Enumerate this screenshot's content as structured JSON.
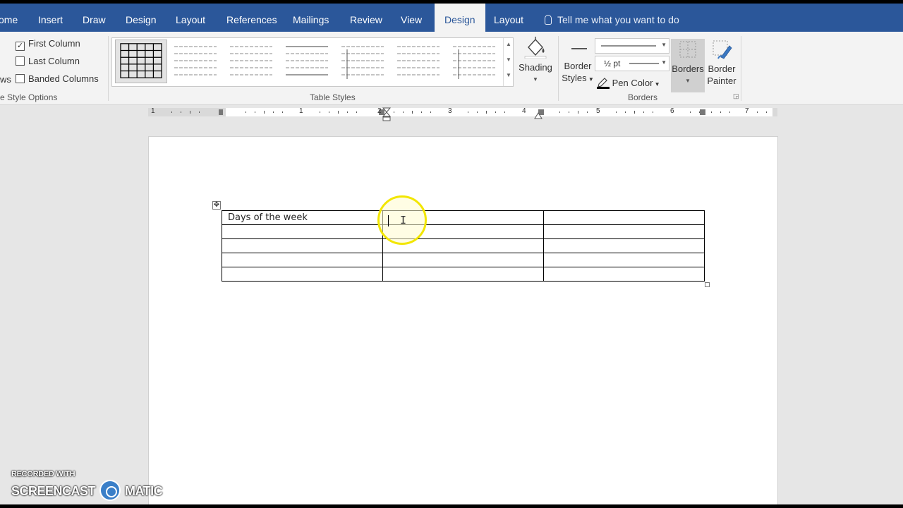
{
  "tabs": {
    "home": "ome",
    "insert": "Insert",
    "draw": "Draw",
    "design": "Design",
    "layout": "Layout",
    "references": "References",
    "mailings": "Mailings",
    "review": "Review",
    "view": "View",
    "table_design": "Design",
    "table_layout": "Layout"
  },
  "tell_me": "Tell me what you want to do",
  "style_options": {
    "header_row_cut": "",
    "first_column": "First Column",
    "first_column_checked": true,
    "last_column": "Last Column",
    "last_column_checked": false,
    "banded_rows_cut": "ws",
    "banded_columns": "Banded Columns",
    "banded_columns_checked": false,
    "group_label": "e Style Options"
  },
  "table_styles": {
    "group_label": "Table Styles",
    "count_visible": 7
  },
  "shading": {
    "label": "Shading"
  },
  "borders_group": {
    "border_styles_line1": "Border",
    "border_styles_line2": "Styles",
    "line_weight": "½ pt",
    "pen_color": "Pen Color",
    "borders": "Borders",
    "border_painter_line1": "Border",
    "border_painter_line2": "Painter",
    "group_label": "Borders"
  },
  "ruler_numbers": [
    "1",
    "1",
    "2",
    "3",
    "4",
    "5",
    "6",
    "7"
  ],
  "document": {
    "cell_0_0": "Days of the week"
  },
  "watermark": {
    "line1": "RECORDED WITH",
    "line2a": "SCREENCAST",
    "line2b": "MATIC"
  },
  "colors": {
    "ribbon_blue": "#2b579a",
    "highlight_yellow": "#f2e600"
  }
}
